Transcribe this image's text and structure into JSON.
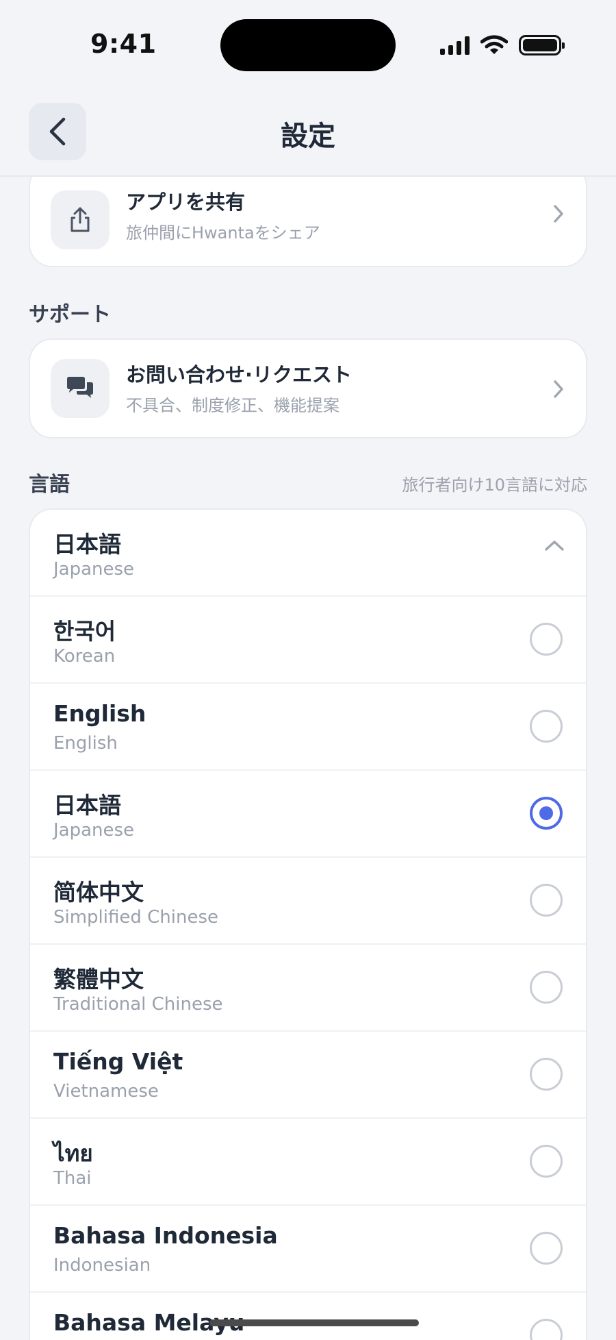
{
  "status_bar": {
    "time": "9:41"
  },
  "nav": {
    "title": "設定"
  },
  "share_row": {
    "title": "アプリを共有",
    "subtitle": "旅仲間にHwantaをシェア"
  },
  "support": {
    "section_label": "サポート",
    "row": {
      "title": "お問い合わせ·リクエスト",
      "subtitle": "不具合、制度修正、機能提案"
    }
  },
  "language": {
    "section_label": "言語",
    "section_note": "旅行者向け10言語に対応",
    "current": {
      "name": "日本語",
      "english": "Japanese"
    },
    "options": [
      {
        "name": "한국어",
        "english": "Korean",
        "selected": false
      },
      {
        "name": "English",
        "english": "English",
        "selected": false
      },
      {
        "name": "日本語",
        "english": "Japanese",
        "selected": true
      },
      {
        "name": "简体中文",
        "english": "Simplified Chinese",
        "selected": false
      },
      {
        "name": "繁體中文",
        "english": "Traditional Chinese",
        "selected": false
      },
      {
        "name": "Tiếng Việt",
        "english": "Vietnamese",
        "selected": false
      },
      {
        "name": "ไทย",
        "english": "Thai",
        "selected": false
      },
      {
        "name": "Bahasa Indonesia",
        "english": "Indonesian",
        "selected": false
      },
      {
        "name": "Bahasa Melayu",
        "english": "",
        "selected": false
      }
    ]
  },
  "colors": {
    "accent": "#4f6ae6",
    "background": "#f3f4f7"
  }
}
